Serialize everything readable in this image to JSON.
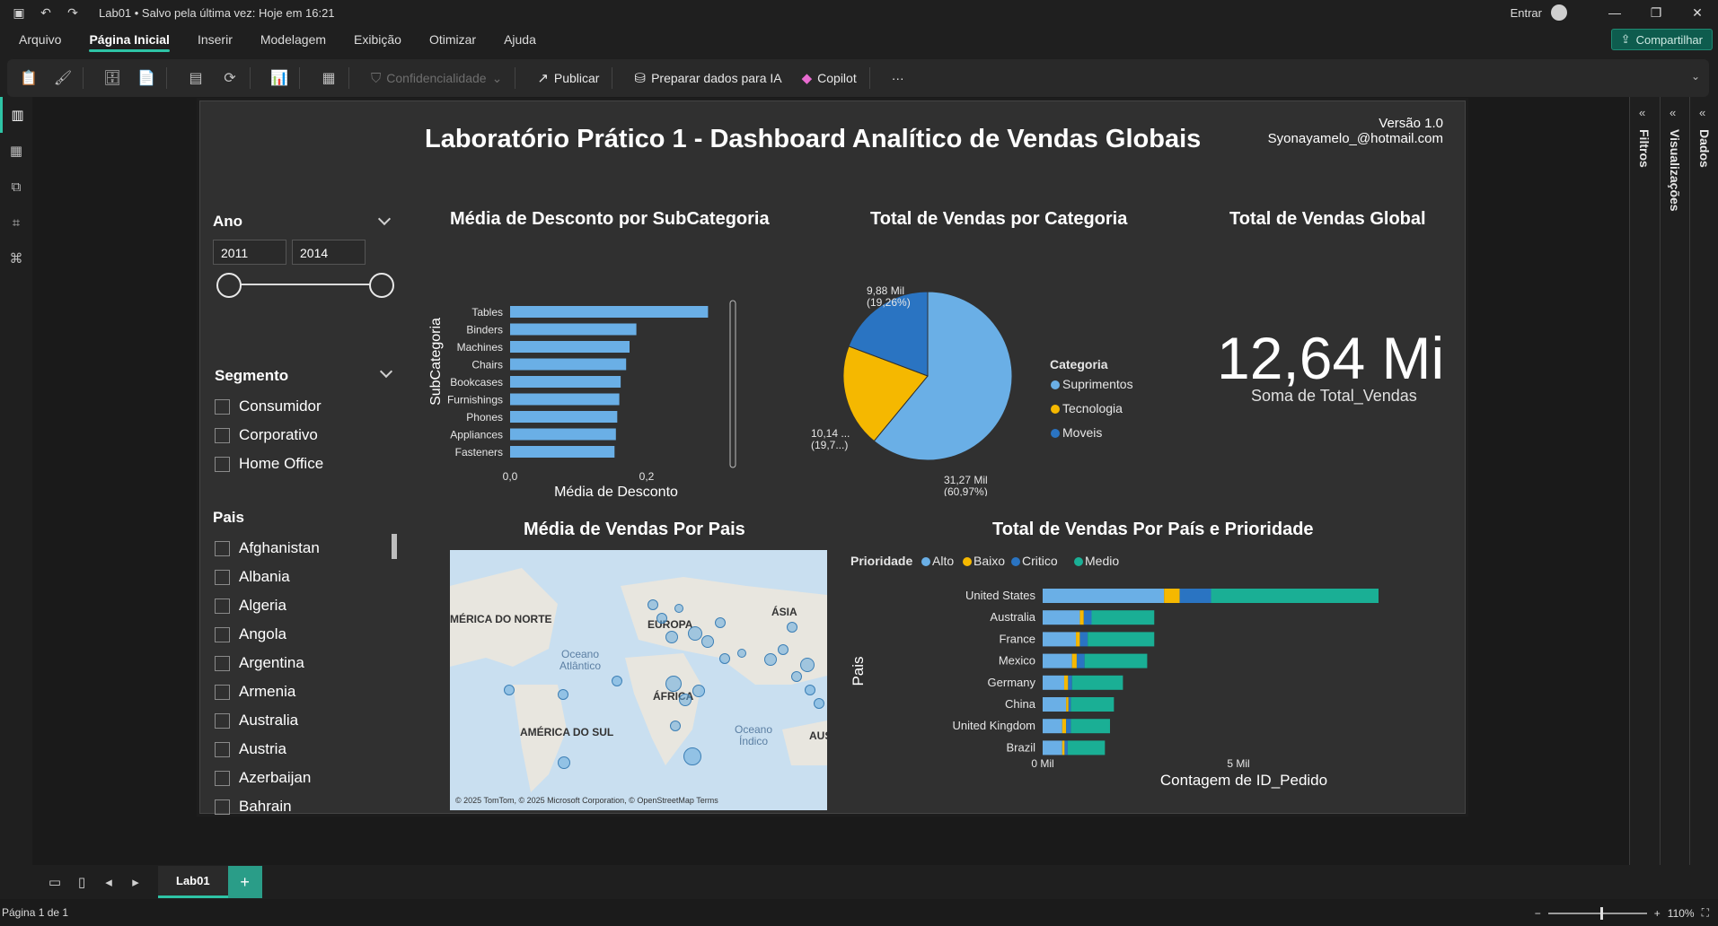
{
  "titlebar": {
    "doc_title": "Lab01 • Salvo pela última vez: Hoje em 16:21",
    "signin": "Entrar"
  },
  "menu": {
    "items": [
      "Arquivo",
      "Página Inicial",
      "Inserir",
      "Modelagem",
      "Exibição",
      "Otimizar",
      "Ajuda"
    ],
    "active": "Página Inicial",
    "share": "Compartilhar"
  },
  "ribbon": {
    "sensitivity": "Confidencialidade",
    "publish": "Publicar",
    "prepare_ai": "Preparar dados para IA",
    "copilot": "Copilot",
    "more": "···"
  },
  "report": {
    "title": "Laboratório Prático 1 - Dashboard Analítico de Vendas Globais",
    "version": "Versão 1.0",
    "email": "Syonayamelo_@hotmail.com"
  },
  "slicers": {
    "ano": {
      "title": "Ano",
      "from": "2011",
      "to": "2014"
    },
    "segmento": {
      "title": "Segmento",
      "items": [
        "Consumidor",
        "Corporativo",
        "Home Office"
      ]
    },
    "pais": {
      "title": "Pais",
      "items": [
        "Afghanistan",
        "Albania",
        "Algeria",
        "Angola",
        "Argentina",
        "Armenia",
        "Australia",
        "Austria",
        "Azerbaijan",
        "Bahrain"
      ]
    }
  },
  "kpi": {
    "title": "Total de Vendas Global",
    "value": "12,64 Mi",
    "label": "Soma de Total_Vendas"
  },
  "map": {
    "title": "Média de Vendas Por Pais",
    "labels": [
      "MÉRICA DO NORTE",
      "EUROPA",
      "ÁSIA",
      "ÁFRICA",
      "AMÉRICA DO SUL",
      "AUS"
    ],
    "oceans": [
      "Oceano Atlântico",
      "Oceano Índico"
    ],
    "footer": "© 2025 TomTom, © 2025 Microsoft Corporation, © OpenStreetMap  Terms"
  },
  "tabs": {
    "page": "Lab01",
    "add": "+"
  },
  "status": {
    "page_info": "Página 1 de 1",
    "zoom": "110%"
  },
  "panes": {
    "filters": "Filtros",
    "visualizations": "Visualizações",
    "data": "Dados"
  },
  "chart_data": [
    {
      "type": "bar",
      "title": "Média de Desconto por SubCategoria",
      "xlabel": "Média de Desconto",
      "ylabel": "SubCategoria",
      "categories": [
        "Tables",
        "Binders",
        "Machines",
        "Chairs",
        "Bookcases",
        "Furnishings",
        "Phones",
        "Appliances",
        "Fasteners"
      ],
      "values": [
        0.29,
        0.185,
        0.175,
        0.17,
        0.162,
        0.16,
        0.157,
        0.155,
        0.153
      ],
      "xticks": [
        "0,0",
        "0,2"
      ],
      "xlim": [
        0,
        0.3
      ],
      "color": "#6aafe6"
    },
    {
      "type": "pie",
      "title": "Total de Vendas por Categoria",
      "legend_title": "Categoria",
      "categories": [
        "Suprimentos",
        "Tecnologia",
        "Moveis"
      ],
      "values": [
        31.27,
        10.14,
        9.88
      ],
      "labels": [
        {
          "value": "31,27 Mil",
          "pct": "(60,97%)"
        },
        {
          "value": "10,14 ...",
          "pct": "(19,7...)"
        },
        {
          "value": "9,88 Mil",
          "pct": "(19,26%)"
        }
      ],
      "colors": [
        "#6aafe6",
        "#f5b800",
        "#2a74c2"
      ]
    },
    {
      "type": "bar",
      "title": "Total de Vendas Por País e Prioridade",
      "legend_title": "Prioridade",
      "xlabel": "Contagem de ID_Pedido",
      "ylabel": "Pais",
      "categories": [
        "United States",
        "Australia",
        "France",
        "Mexico",
        "Germany",
        "China",
        "United Kingdom",
        "Brazil"
      ],
      "series": [
        {
          "name": "Alto",
          "color": "#6aafe6",
          "values": [
            3.1,
            0.95,
            0.85,
            0.75,
            0.55,
            0.6,
            0.5,
            0.5
          ]
        },
        {
          "name": "Baixo",
          "color": "#f5b800",
          "values": [
            0.4,
            0.1,
            0.1,
            0.12,
            0.1,
            0.06,
            0.1,
            0.06
          ]
        },
        {
          "name": "Critico",
          "color": "#2a74c2",
          "values": [
            0.8,
            0.2,
            0.2,
            0.2,
            0.1,
            0.06,
            0.12,
            0.08
          ]
        },
        {
          "name": "Medio",
          "color": "#1aaf95",
          "values": [
            5.7,
            1.6,
            1.7,
            1.6,
            1.3,
            1.1,
            1.0,
            0.95
          ]
        }
      ],
      "xticks": [
        "0 Mil",
        "5 Mil",
        "10 Mil"
      ],
      "xlim": [
        0,
        10
      ]
    }
  ]
}
